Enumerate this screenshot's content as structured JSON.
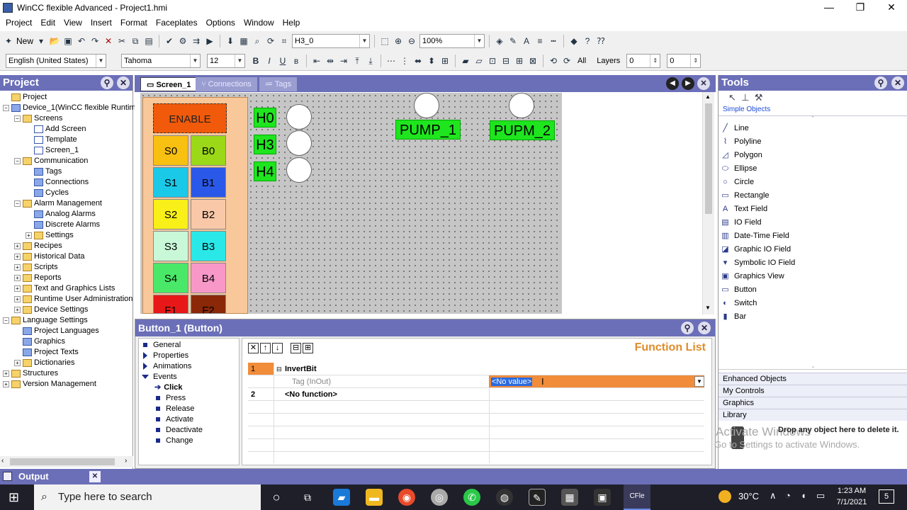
{
  "window": {
    "title": "WinCC flexible Advanced - Project1.hmi",
    "min": "—",
    "max": "❐",
    "close": "✕"
  },
  "menu": [
    "Project",
    "Edit",
    "View",
    "Insert",
    "Format",
    "Faceplates",
    "Options",
    "Window",
    "Help"
  ],
  "toolbar": {
    "new_label": "New",
    "tag_combo": "H3_0",
    "zoom_combo": "100%",
    "language_combo": "English (United States)",
    "font_combo": "Tahoma",
    "size_combo": "12",
    "all_label": "All",
    "layers_label": "Layers",
    "layer_from": "0",
    "layer_to": "0"
  },
  "project": {
    "title": "Project",
    "tree": [
      {
        "label": "Project",
        "level": 0,
        "icon": "folder"
      },
      {
        "label": "Device_1(WinCC flexible Runtim",
        "level": 0,
        "icon": "device",
        "toggle": "−"
      },
      {
        "label": "Screens",
        "level": 1,
        "icon": "folder",
        "toggle": "−"
      },
      {
        "label": "Add Screen",
        "level": 2,
        "icon": "screen"
      },
      {
        "label": "Template",
        "level": 2,
        "icon": "screen"
      },
      {
        "label": "Screen_1",
        "level": 2,
        "icon": "screen"
      },
      {
        "label": "Communication",
        "level": 1,
        "icon": "folder",
        "toggle": "−"
      },
      {
        "label": "Tags",
        "level": 2,
        "icon": "blue"
      },
      {
        "label": "Connections",
        "level": 2,
        "icon": "blue"
      },
      {
        "label": "Cycles",
        "level": 2,
        "icon": "blue"
      },
      {
        "label": "Alarm Management",
        "level": 1,
        "icon": "folder",
        "toggle": "−"
      },
      {
        "label": "Analog Alarms",
        "level": 2,
        "icon": "blue"
      },
      {
        "label": "Discrete Alarms",
        "level": 2,
        "icon": "blue"
      },
      {
        "label": "Settings",
        "level": 2,
        "icon": "folder",
        "toggle": "+"
      },
      {
        "label": "Recipes",
        "level": 1,
        "icon": "folder",
        "toggle": "+"
      },
      {
        "label": "Historical Data",
        "level": 1,
        "icon": "folder",
        "toggle": "+"
      },
      {
        "label": "Scripts",
        "level": 1,
        "icon": "folder",
        "toggle": "+"
      },
      {
        "label": "Reports",
        "level": 1,
        "icon": "folder",
        "toggle": "+"
      },
      {
        "label": "Text and Graphics Lists",
        "level": 1,
        "icon": "folder",
        "toggle": "+"
      },
      {
        "label": "Runtime User Administration",
        "level": 1,
        "icon": "folder",
        "toggle": "+"
      },
      {
        "label": "Device Settings",
        "level": 1,
        "icon": "folder",
        "toggle": "+"
      },
      {
        "label": "Language Settings",
        "level": 0,
        "icon": "folder",
        "toggle": "−"
      },
      {
        "label": "Project Languages",
        "level": 1,
        "icon": "blue"
      },
      {
        "label": "Graphics",
        "level": 1,
        "icon": "blue"
      },
      {
        "label": "Project Texts",
        "level": 1,
        "icon": "blue"
      },
      {
        "label": "Dictionaries",
        "level": 1,
        "icon": "folder",
        "toggle": "+"
      },
      {
        "label": "Structures",
        "level": 0,
        "icon": "folder",
        "toggle": "+"
      },
      {
        "label": "Version Management",
        "level": 0,
        "icon": "folder",
        "toggle": "+"
      }
    ]
  },
  "editor": {
    "tabs": [
      {
        "label": "Screen_1",
        "active": true
      },
      {
        "label": "Connections",
        "active": false
      },
      {
        "label": "Tags",
        "active": false
      }
    ],
    "buttons": {
      "enable": "ENABLE",
      "s0": "S0",
      "b0": "B0",
      "s1": "S1",
      "b1": "B1",
      "s2": "S2",
      "b2": "B2",
      "s3": "S3",
      "b3": "B3",
      "s4": "S4",
      "b4": "B4",
      "f1": "F1",
      "f2": "F2"
    },
    "labels": {
      "h0": "H0",
      "h3": "H3",
      "h4": "H4",
      "pump1": "PUMP_1",
      "pump2": "PUPM_2"
    }
  },
  "properties": {
    "title": "Button_1 (Button)",
    "nav": {
      "general": "General",
      "properties": "Properties",
      "animations": "Animations",
      "events": "Events",
      "click": "Click",
      "press": "Press",
      "release": "Release",
      "activate": "Activate",
      "deactivate": "Deactivate",
      "change": "Change"
    },
    "function_list_title": "Function List",
    "rows": {
      "r1_num": "1",
      "r1_func": "InvertBit",
      "r1_param": "Tag (InOut)",
      "r1_value": "<No value>",
      "r2_num": "2",
      "r2_func": "<No function>"
    }
  },
  "tools": {
    "title": "Tools",
    "simple_objects": "Simple Objects",
    "items": [
      "Line",
      "Polyline",
      "Polygon",
      "Ellipse",
      "Circle",
      "Rectangle",
      "Text Field",
      "IO Field",
      "Date-Time Field",
      "Graphic IO Field",
      "Symbolic IO Field",
      "Graphics View",
      "Button",
      "Switch",
      "Bar"
    ],
    "categories": [
      "Enhanced Objects",
      "My Controls",
      "Graphics",
      "Library"
    ],
    "drop_hint": "Drop any object here to delete it.",
    "watermark_1": "Activate Windows",
    "watermark_2": "Go to Settings to activate Windows."
  },
  "output": {
    "label": "Output"
  },
  "taskbar": {
    "search_placeholder": "Type here to search",
    "weather": "30°C",
    "time": "1:23 AM",
    "date": "7/1/2021",
    "notif_count": "5"
  }
}
